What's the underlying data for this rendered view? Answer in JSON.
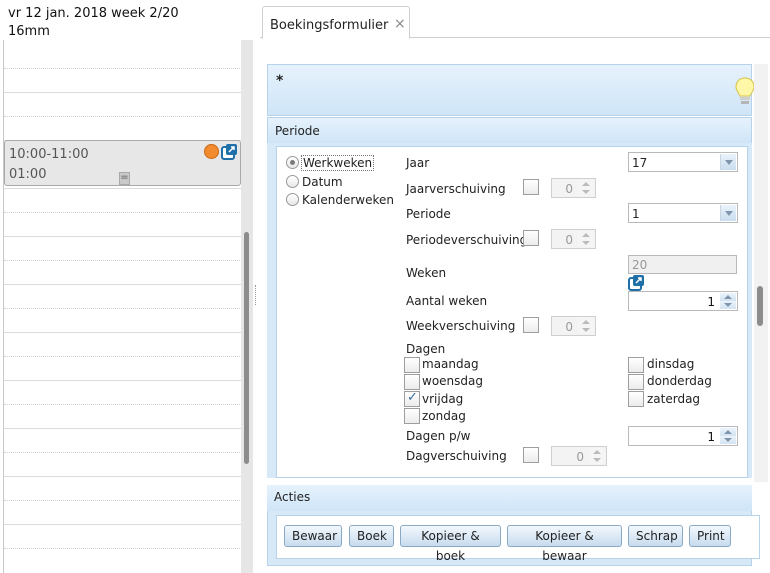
{
  "calendar": {
    "date_label": "vr 12 jan. 2018 week 2/20",
    "unit_label": "16mm",
    "appointment": {
      "time": "10:00-11:00",
      "duration": "01:00",
      "grip": "="
    }
  },
  "tab": {
    "label": "Boekingsformulier",
    "close": "×"
  },
  "form": {
    "star": "*"
  },
  "periode": {
    "title": "Periode",
    "options": [
      "Werkweken",
      "Datum",
      "Kalenderweken"
    ],
    "selected_option": "Werkweken",
    "jaar": {
      "label": "Jaar",
      "value": "17"
    },
    "jaarverschuiving": {
      "label": "Jaarverschuiving",
      "value": "0"
    },
    "periode_field": {
      "label": "Periode",
      "value": "1"
    },
    "periodeverschuiving": {
      "label": "Periodeverschuiving",
      "value": "0"
    },
    "weken": {
      "label": "Weken",
      "value": "20"
    },
    "aantal_weken": {
      "label": "Aantal weken",
      "value": "1"
    },
    "weekverschuiving": {
      "label": "Weekverschuiving",
      "value": "0"
    },
    "dagen": {
      "label": "Dagen",
      "days": [
        {
          "name": "maandag",
          "checked": false
        },
        {
          "name": "dinsdag",
          "checked": false
        },
        {
          "name": "woensdag",
          "checked": false
        },
        {
          "name": "donderdag",
          "checked": false
        },
        {
          "name": "vrijdag",
          "checked": true
        },
        {
          "name": "zaterdag",
          "checked": false
        },
        {
          "name": "zondag",
          "checked": false
        }
      ]
    },
    "dagen_pw": {
      "label": "Dagen p/w",
      "value": "1"
    },
    "dagverschuiving": {
      "label": "Dagverschuiving",
      "value": "0"
    }
  },
  "acties": {
    "title": "Acties",
    "buttons": [
      "Bewaar",
      "Boek",
      "Kopieer & boek",
      "Kopieer & bewaar",
      "Schrap",
      "Print"
    ]
  },
  "colors": {
    "panel_header": "#cfe5f8",
    "appointment_dot": "#f28a2e",
    "link_icon": "#1f6fa8"
  }
}
